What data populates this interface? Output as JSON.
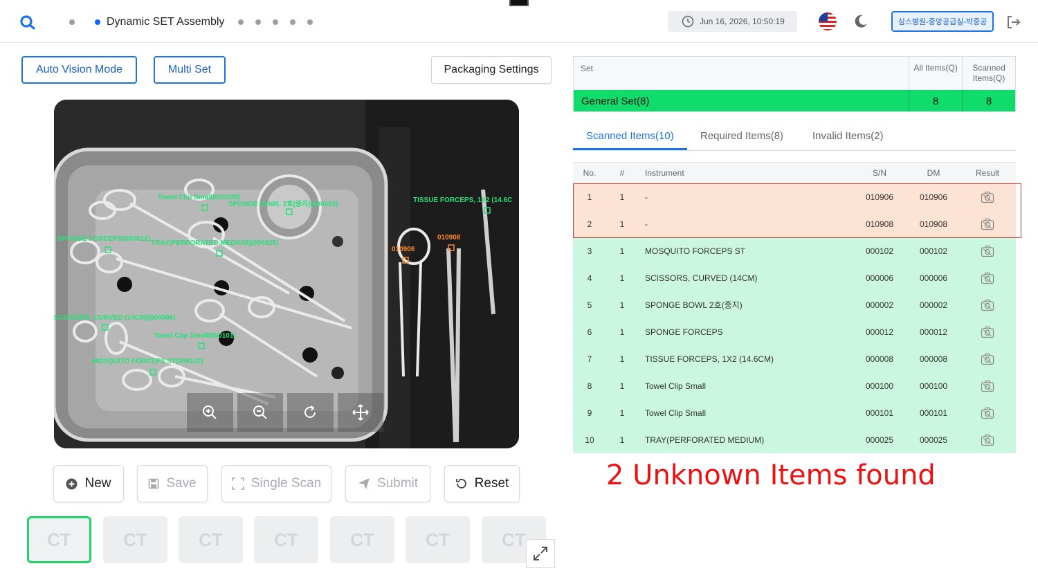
{
  "header": {
    "step_title": "Dynamic SET Assembly",
    "datetime": "Jun 16, 2026, 10:50:19",
    "user_label": "심스병원-중앙공급실-박중공",
    "accent": "#1a73e8"
  },
  "toolbar": {
    "auto_vision": "Auto Vision Mode",
    "multi_set": "Multi Set",
    "packaging": "Packaging Settings"
  },
  "camera": {
    "labels": [
      {
        "text": "Towel Clip Small(000100)",
        "color": "#27e07a"
      },
      {
        "text": "SPONGE BOWL 2호(중지)(000002)",
        "color": "#27e07a"
      },
      {
        "text": "TISSUE FORCEPS, 1X2 (14.6C",
        "color": "#27e07a"
      },
      {
        "text": "SPONGE FORCEPS(000012)",
        "color": "#27e07a"
      },
      {
        "text": "TRAY(PERFORATED MEDIUM)(000025)",
        "color": "#27e07a"
      },
      {
        "text": "010906",
        "color": "#ff8a2b"
      },
      {
        "text": "010908",
        "color": "#ff8a2b"
      },
      {
        "text": "SCISSORS, CURVED (14CM)(000006)",
        "color": "#27e07a"
      },
      {
        "text": "Towel Clip Small(000101)",
        "color": "#27e07a"
      },
      {
        "text": "MOSQUITO FORCEPS ST(000102)",
        "color": "#27e07a"
      }
    ]
  },
  "actions": {
    "new": "New",
    "save": "Save",
    "single_scan": "Single Scan",
    "submit": "Submit",
    "reset": "Reset"
  },
  "thumbnails": [
    "CT",
    "CT",
    "CT",
    "CT",
    "CT",
    "CT",
    "CT"
  ],
  "set_table": {
    "col_set": "Set",
    "col_all": "All Items(Q)",
    "col_scanned": "Scanned Items(Q)",
    "row_name": "General Set(8)",
    "row_all": "8",
    "row_scanned": "8",
    "row_color": "#0fdc6a"
  },
  "tabs": {
    "scanned": "Scanned Items(10)",
    "required": "Required Items(8)",
    "invalid": "Invalid Items(2)"
  },
  "items_table": {
    "headers": {
      "no": "No.",
      "count": "#",
      "instrument": "Instrument",
      "sn": "S/N",
      "dm": "DM",
      "result": "Result"
    },
    "rows": [
      {
        "no": "1",
        "count": "1",
        "instrument": "-",
        "sn": "010906",
        "dm": "010906",
        "status": "unknown"
      },
      {
        "no": "2",
        "count": "1",
        "instrument": "-",
        "sn": "010908",
        "dm": "010908",
        "status": "unknown"
      },
      {
        "no": "3",
        "count": "1",
        "instrument": "MOSQUITO FORCEPS ST",
        "sn": "000102",
        "dm": "000102",
        "status": "ok"
      },
      {
        "no": "4",
        "count": "1",
        "instrument": "SCISSORS, CURVED (14CM)",
        "sn": "000006",
        "dm": "000006",
        "status": "ok"
      },
      {
        "no": "5",
        "count": "1",
        "instrument": "SPONGE BOWL 2호(중지)",
        "sn": "000002",
        "dm": "000002",
        "status": "ok"
      },
      {
        "no": "6",
        "count": "1",
        "instrument": "SPONGE FORCEPS",
        "sn": "000012",
        "dm": "000012",
        "status": "ok"
      },
      {
        "no": "7",
        "count": "1",
        "instrument": "TISSUE FORCEPS, 1X2 (14.6CM)",
        "sn": "000008",
        "dm": "000008",
        "status": "ok"
      },
      {
        "no": "8",
        "count": "1",
        "instrument": "Towel Clip Small",
        "sn": "000100",
        "dm": "000100",
        "status": "ok"
      },
      {
        "no": "9",
        "count": "1",
        "instrument": "Towel Clip Small",
        "sn": "000101",
        "dm": "000101",
        "status": "ok"
      },
      {
        "no": "10",
        "count": "1",
        "instrument": "TRAY(PERFORATED MEDIUM)",
        "sn": "000025",
        "dm": "000025",
        "status": "ok"
      }
    ]
  },
  "annotation": "2 Unknown Items found"
}
